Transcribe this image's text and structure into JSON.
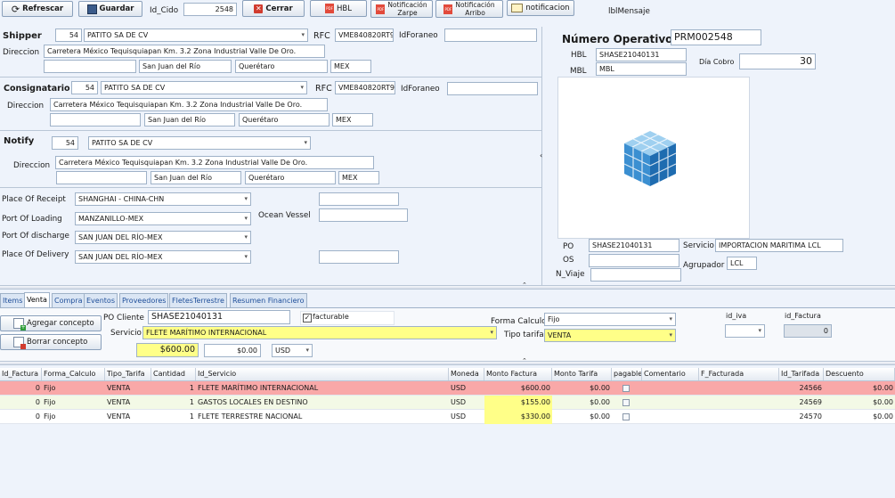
{
  "toolbar": {
    "refresh": "Refrescar",
    "save": "Guardar",
    "id_cido_label": "Id_Cido",
    "id_cido_value": "2548",
    "close": "Cerrar",
    "hbl": "HBL",
    "notif_zarpe": "Notificación\nZarpe",
    "notif_arribo": "Notificación\nArribo",
    "notification": "notificacion",
    "lbl_mensaje": "lblMensaje"
  },
  "shipper": {
    "title": "Shipper",
    "id": "54",
    "name": "PATITO SA DE CV",
    "rfc_label": "RFC",
    "rfc": "VME840820RT9",
    "idforaneo_label": "IdForaneo",
    "idforaneo": "",
    "dir_label": "Direccion",
    "address": "Carretera México Tequisquiapan Km. 3.2  Zona Industrial Valle De Oro.",
    "addr2": "",
    "city": "San Juan del Río",
    "state": "Querétaro",
    "country": "MEX"
  },
  "consignee": {
    "title": "Consignatario",
    "id": "54",
    "name": "PATITO SA DE CV",
    "rfc_label": "RFC",
    "rfc": "VME840820RT9",
    "idforaneo_label": "IdForaneo",
    "idforaneo": "",
    "dir_label": "Direccion",
    "address": "Carretera México Tequisquiapan Km. 3.2  Zona Industrial Valle De Oro.",
    "addr2": "",
    "city": "San Juan del Río",
    "state": "Querétaro",
    "country": "MEX"
  },
  "notify": {
    "title": "Notify",
    "id": "54",
    "name": "PATITO SA DE CV",
    "dir_label": "Direccion",
    "address": "Carretera México Tequisquiapan Km. 3.2  Zona Industrial Valle De Oro.",
    "addr2": "",
    "city": "San Juan del Río",
    "state": "Querétaro",
    "country": "MEX"
  },
  "route": {
    "receipt_label": "Place Of Receipt",
    "receipt": "SHANGHAI - CHINA-CHN",
    "loading_label": "Port Of Loading",
    "loading": "MANZANILLO-MEX",
    "discharge_label": "Port Of discharge",
    "discharge": "SAN JUAN DEL RÍO-MEX",
    "delivery_label": "Place Of Delivery",
    "delivery": "SAN JUAN DEL RÍO-MEX",
    "vessel_label": "Ocean Vessel",
    "vessel": ""
  },
  "operation": {
    "num_label": "Número Operativo",
    "num": "PRM002548",
    "hbl_label": "HBL",
    "hbl": "SHASE21040131",
    "mbl_label": "MBL",
    "mbl": "MBL",
    "dia_cobro_label": "Día Cobro",
    "dia_cobro": "30",
    "po_label": "PO",
    "po": "SHASE21040131",
    "os_label": "OS",
    "os": "",
    "nviaje_label": "N_Viaje",
    "nviaje": "",
    "servicio_label": "Servicio",
    "servicio": "IMPORTACION MARITIMA LCL",
    "agrupador_label": "Agrupador",
    "agrupador": "LCL"
  },
  "tabs": [
    "Items",
    "Venta",
    "Compra",
    "Eventos",
    "Proveedores",
    "FletesTerrestre",
    "Resumen Financiero"
  ],
  "venta": {
    "add_concept": "Agregar concepto",
    "del_concept": "Borrar concepto",
    "po_cliente_label": "PO Cliente",
    "po_cliente": "SHASE21040131",
    "facturable_label": "facturable",
    "servicio_label": "Servicio",
    "servicio": "FLETE MARÍTIMO INTERNACIONAL",
    "amount": "$600.00",
    "amount2": "$0.00",
    "currency": "USD",
    "forma_calculo_label": "Forma Calculo",
    "forma_calculo": "Fijo",
    "tipo_tarifa_label": "Tipo tarifa",
    "tipo_tarifa": "VENTA",
    "id_iva_label": "id_iva",
    "id_iva": "",
    "id_factura_label": "id_Factura",
    "id_factura": "0"
  },
  "grid": {
    "columns": [
      "Id_Factura",
      "Forma_Calculo",
      "Tipo_Tarifa",
      "Cantidad",
      "Id_Servicio",
      "Moneda",
      "Monto Factura",
      "Monto Tarifa",
      "pagable",
      "Comentario",
      "F_Facturada",
      "Id_Tarifada",
      "Descuento"
    ],
    "rows": [
      {
        "id_factura": "0",
        "forma": "Fijo",
        "tipo": "VENTA",
        "cantidad": "1",
        "servicio": "FLETE MARÍTIMO INTERNACIONAL",
        "moneda": "USD",
        "monto_factura": "$600.00",
        "monto_tarifa": "$0.00",
        "comentario": "",
        "f_facturada": "",
        "id_tarifada": "24566",
        "descuento": "$0.00"
      },
      {
        "id_factura": "0",
        "forma": "Fijo",
        "tipo": "VENTA",
        "cantidad": "1",
        "servicio": "GASTOS LOCALES EN DESTINO",
        "moneda": "USD",
        "monto_factura": "$155.00",
        "monto_tarifa": "$0.00",
        "comentario": "",
        "f_facturada": "",
        "id_tarifada": "24569",
        "descuento": "$0.00"
      },
      {
        "id_factura": "0",
        "forma": "Fijo",
        "tipo": "VENTA",
        "cantidad": "1",
        "servicio": "FLETE TERRESTRE NACIONAL",
        "moneda": "USD",
        "monto_factura": "$330.00",
        "monto_tarifa": "$0.00",
        "comentario": "",
        "f_facturada": "",
        "id_tarifada": "24570",
        "descuento": "$0.00"
      }
    ]
  },
  "colors": {
    "selected_row": "#f9a8a8",
    "alt_row": "#f3f9e6",
    "highlight": "#ffff88"
  }
}
